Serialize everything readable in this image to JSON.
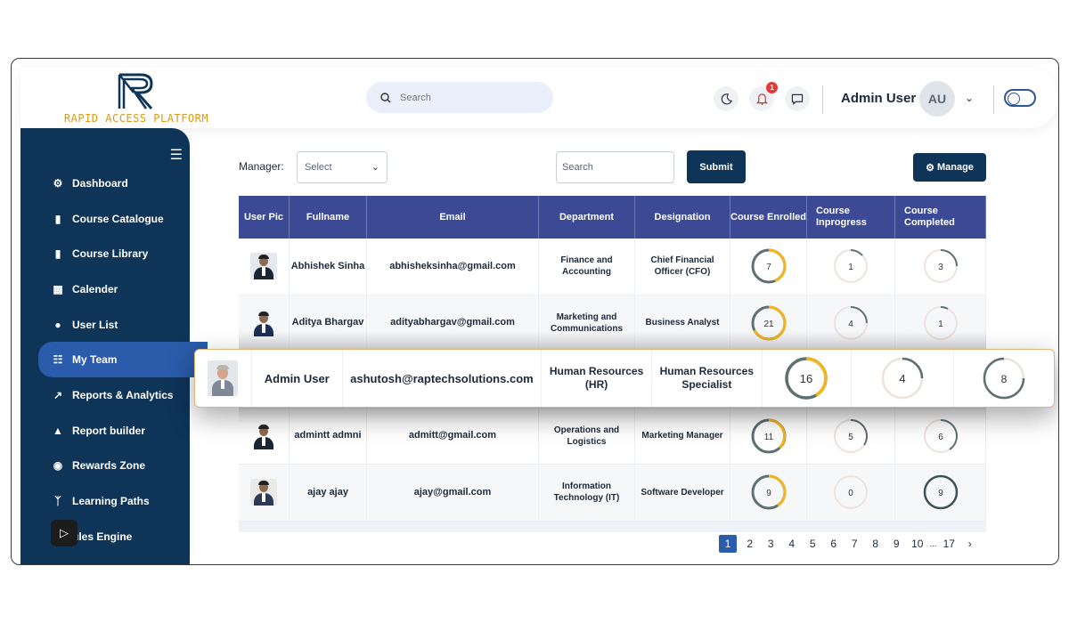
{
  "brand": {
    "logo_text": "RAPID ACCESS PLATFORM"
  },
  "header": {
    "search_placeholder": "Search",
    "notification_count": "1",
    "user_name": "Admin User",
    "avatar_initials": "AU"
  },
  "sidebar": {
    "items": [
      {
        "label": "Dashboard",
        "icon": "dashboard-icon"
      },
      {
        "label": "Course Catalogue",
        "icon": "catalogue-icon"
      },
      {
        "label": "Course Library",
        "icon": "library-icon"
      },
      {
        "label": "Calender",
        "icon": "calendar-icon"
      },
      {
        "label": "User List",
        "icon": "users-icon"
      },
      {
        "label": "My Team",
        "icon": "team-icon"
      },
      {
        "label": "Reports & Analytics",
        "icon": "chart-icon"
      },
      {
        "label": "Report builder",
        "icon": "area-chart-icon"
      },
      {
        "label": "Rewards Zone",
        "icon": "gamepad-icon"
      },
      {
        "label": "Learning Paths",
        "icon": "branch-icon"
      },
      {
        "label": "ules Engine",
        "icon": "rules-icon"
      }
    ],
    "active_index": 5
  },
  "toolbar": {
    "manager_label": "Manager:",
    "select_value": "Select",
    "search_placeholder": "Search",
    "submit_label": "Submit",
    "manage_label": "Manage"
  },
  "table": {
    "headers": [
      "User Pic",
      "Fullname",
      "Email",
      "Department",
      "Designation",
      "Course Enrolled",
      "Course Inprogress",
      "Course Completed"
    ],
    "rows": [
      {
        "name": "Abhishek Sinha",
        "email": "abhisheksinha@gmail.com",
        "department": "Finance and Accounting",
        "designation": "Chief Financial Officer (CFO)",
        "enrolled": "7",
        "inprogress": "1",
        "completed": "3"
      },
      {
        "name": "Aditya Bhargav",
        "email": "adityabhargav@gmail.com",
        "department": "Marketing and Communications",
        "designation": "Business Analyst",
        "enrolled": "21",
        "inprogress": "4",
        "completed": "1"
      },
      {
        "name": "admintt admni",
        "email": "admitt@gmail.com",
        "department": "Operations and Logistics",
        "designation": "Marketing Manager",
        "enrolled": "11",
        "inprogress": "5",
        "completed": "6"
      },
      {
        "name": "ajay ajay",
        "email": "ajay@gmail.com",
        "department": "Information Technology (IT)",
        "designation": "Software Developer",
        "enrolled": "9",
        "inprogress": "0",
        "completed": "9"
      }
    ],
    "highlighted_row": {
      "name": "Admin User",
      "email": "ashutosh@raptechsolutions.com",
      "department": "Human Resources (HR)",
      "designation": "Human Resources Specialist",
      "enrolled": "16",
      "inprogress": "4",
      "completed": "8"
    }
  },
  "pagination": {
    "pages": [
      "1",
      "2",
      "3",
      "4",
      "5",
      "6",
      "7",
      "8",
      "9",
      "10"
    ],
    "ellipsis": "...",
    "last": "17",
    "next": "›",
    "current": "1"
  },
  "colors": {
    "navy": "#0e3458",
    "header_blue": "#3c4a96",
    "accent_gold": "#f2b51d",
    "ring_gray": "#5d7072"
  }
}
